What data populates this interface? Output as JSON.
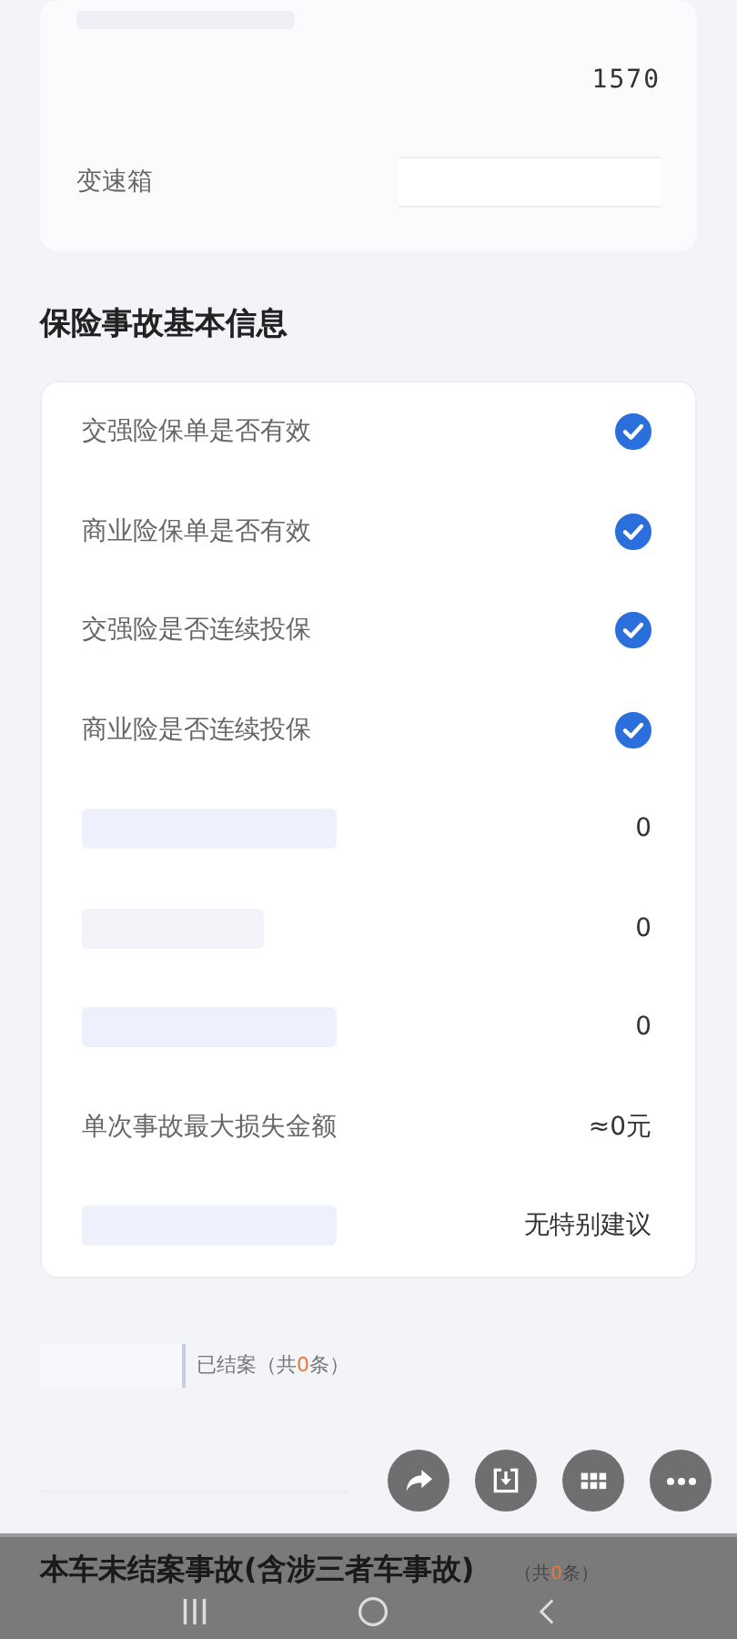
{
  "vehicle_card": {
    "rows": [
      {
        "kind": "value",
        "value": "1570"
      },
      {
        "kind": "field",
        "label": "变速箱"
      }
    ]
  },
  "section_title": "保险事故基本信息",
  "insurance_rows": [
    {
      "kind": "check",
      "label": "交强险保单是否有效",
      "checked": true
    },
    {
      "kind": "check",
      "label": "商业险保单是否有效",
      "checked": true
    },
    {
      "kind": "check",
      "label": "交强险是否连续投保",
      "checked": true
    },
    {
      "kind": "check",
      "label": "商业险是否连续投保",
      "checked": true
    },
    {
      "kind": "value",
      "value": "0"
    },
    {
      "kind": "value",
      "value": "0"
    },
    {
      "kind": "value",
      "value": "0"
    },
    {
      "kind": "value",
      "label": "单次事故最大损失金额",
      "value": "≈0元"
    },
    {
      "kind": "value",
      "value": "无特别建议"
    }
  ],
  "closed_cases": {
    "status": "已结案",
    "count_before": "（共",
    "count": "0",
    "count_after": "条）"
  },
  "bottom_bar": {
    "title": "本车未结案事故(含涉三者车事故)",
    "count_before": "（共",
    "count": "0",
    "count_after": "条）"
  }
}
